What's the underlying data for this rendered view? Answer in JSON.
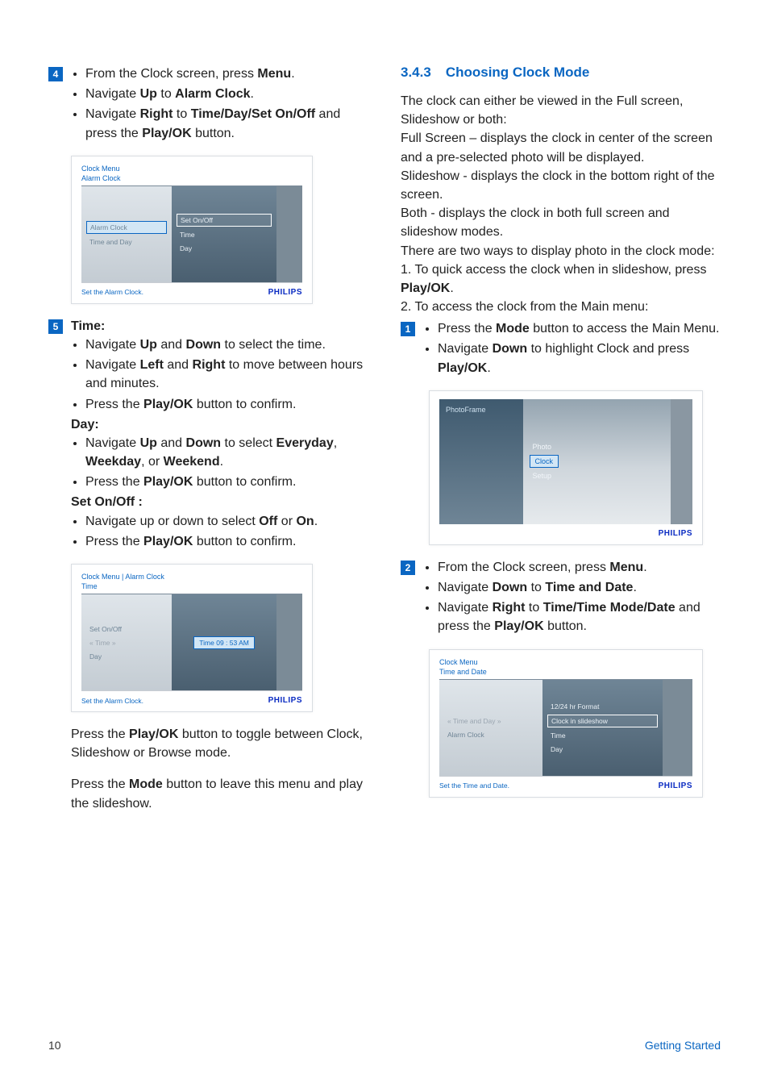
{
  "left": {
    "step4": {
      "num": "4",
      "b1_pre": "From the Clock screen, press ",
      "b1_bold": "Menu",
      "b1_post": ".",
      "b2_pre": "Navigate ",
      "b2_bold1": "Up",
      "b2_mid": " to ",
      "b2_bold2": "Alarm Clock",
      "b2_post": ".",
      "b3_pre": "Navigate ",
      "b3_bold1": "Right",
      "b3_mid1": " to ",
      "b3_bold2": "Time/Day/Set On/Off",
      "b3_mid2": "  and press the ",
      "b3_bold3": "Play/OK",
      "b3_post": " button."
    },
    "fig1": {
      "bc": "Clock Menu",
      "head": "Alarm Clock",
      "left_sel": "Alarm Clock",
      "left_item": "Time and Day",
      "r1": "Set On/Off",
      "r2": "Time",
      "r3": "Day",
      "hint": "Set the Alarm Clock.",
      "brand": "PHILIPS"
    },
    "step5": {
      "num": "5",
      "time_head": "Time:",
      "t1_pre": "Navigate ",
      "t1_b1": "Up",
      "t1_mid": " and ",
      "t1_b2": "Down",
      "t1_post": " to select the time.",
      "t2_pre": "Navigate ",
      "t2_b1": "Left",
      "t2_mid": " and ",
      "t2_b2": "Right",
      "t2_post": " to move between hours and minutes.",
      "t3_pre": "Press the ",
      "t3_b": "Play/OK",
      "t3_post": " button to confirm.",
      "day_head": "Day:",
      "d1_pre": "Navigate ",
      "d1_b1": "Up",
      "d1_m1": " and ",
      "d1_b2": "Down",
      "d1_m2": " to select ",
      "d1_b3": "Everyday",
      "d1_m3": ", ",
      "d1_b4": "Weekday",
      "d1_m4": ", or ",
      "d1_b5": "Weekend",
      "d1_post": ".",
      "d2_pre": "Press the ",
      "d2_b": "Play/OK",
      "d2_post": " button to confirm.",
      "set_head": "Set On/Off :",
      "s1_pre": "Navigate up or down to select ",
      "s1_b1": "Off",
      "s1_mid": " or ",
      "s1_b2": "On",
      "s1_post": ".",
      "s2_pre": "Press the ",
      "s2_b": "Play/OK",
      "s2_post": " button to confirm."
    },
    "fig2": {
      "bc": "Clock Menu | Alarm Clock",
      "head": "Time",
      "l1": "Set On/Off",
      "l2": "« Time »",
      "l3": "Day",
      "rval": "Time 09 : 53  AM",
      "hint": "Set the Alarm Clock.",
      "brand": "PHILIPS"
    },
    "p1_pre": "Press the ",
    "p1_b": "Play/OK",
    "p1_post": " button to toggle between Clock, Slideshow or Browse mode.",
    "p2_pre": "Press the ",
    "p2_b": "Mode",
    "p2_post": " button to leave this menu and play the slideshow."
  },
  "right": {
    "heading_num": "3.4.3",
    "heading_txt": "Choosing Clock Mode",
    "intro1": "The clock can either be viewed in the Full screen, Slideshow or both:",
    "intro2": "Full Screen – displays the clock in center of the screen and a pre-selected photo will be displayed.",
    "intro3": "Slideshow  - displays the clock in the bottom right of the screen.",
    "intro4": "Both  - displays the clock in both full screen and slideshow modes.",
    "intro5": "There are two ways to display photo in the clock mode:",
    "intro6_pre": "1. To quick access the clock when in slideshow, press ",
    "intro6_b": "Play/OK",
    "intro6_post": ".",
    "intro7": "2. To access the clock from the Main menu:",
    "step1": {
      "num": "1",
      "a_pre": "Press the ",
      "a_b": "Mode",
      "a_post": " button to access the Main Menu.",
      "b_pre": "Navigate ",
      "b_b1": "Down",
      "b_mid": " to highlight Clock and press ",
      "b_b2": "Play/OK",
      "b_post": "."
    },
    "figA": {
      "pf": "PhotoFrame",
      "m1": "Photo",
      "m2": "Clock",
      "m3": "Setup",
      "brand": "PHILIPS"
    },
    "step2": {
      "num": "2",
      "a_pre": "From the Clock screen, press ",
      "a_b": "Menu",
      "a_post": ".",
      "b_pre": "Navigate ",
      "b_b1": "Down",
      "b_mid": " to ",
      "b_b2": "Time and Date",
      "b_post": ".",
      "c_pre": "Navigate ",
      "c_b1": "Right",
      "c_mid1": " to ",
      "c_b2": "Time/Time Mode/Date",
      "c_mid2": " and press the ",
      "c_b3": "Play/OK",
      "c_post": " button."
    },
    "figB": {
      "bc": "Clock Menu",
      "head": "Time and Date",
      "l1": "« Time and Day »",
      "l2": "Alarm Clock",
      "r1": "12/24 hr Format",
      "r2": "Clock in slideshow",
      "r3": "Time",
      "r4": "Day",
      "hint": "Set the Time and Date.",
      "brand": "PHILIPS"
    }
  },
  "footer": {
    "page": "10",
    "section": "Getting Started"
  }
}
